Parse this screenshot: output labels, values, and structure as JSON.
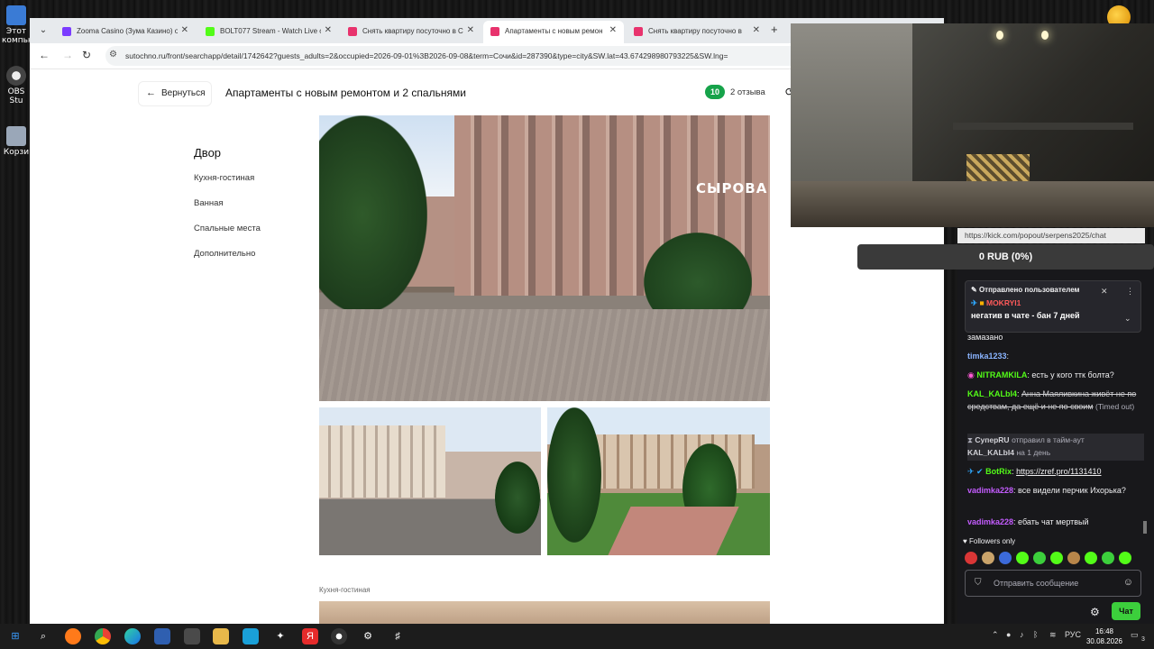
{
  "desktop": {
    "icons": [
      {
        "label": "Этот компью",
        "icon": "computer-icon",
        "color": "#3a7bd5"
      },
      {
        "label": "OBS Stu",
        "icon": "obs-icon",
        "color": "#444444"
      },
      {
        "label": "Корзи",
        "icon": "recycle-bin-icon",
        "color": "#9aa7b8"
      }
    ]
  },
  "browser": {
    "tabs": [
      {
        "title": "Zooma Casino (Зума Казино) о",
        "favicon_color": "#7b3cff",
        "active": false
      },
      {
        "title": "BOLT077 Stream - Watch Live o",
        "favicon_color": "#53fc18",
        "active": false
      },
      {
        "title": "Снять квартиру посуточно в С",
        "favicon_color": "#e8336d",
        "active": false
      },
      {
        "title": "Апартаменты с новым ремон",
        "favicon_color": "#e8336d",
        "active": true
      },
      {
        "title": "Снять квартиру посуточно в",
        "favicon_color": "#e8336d",
        "active": false
      }
    ],
    "url": "sutochno.ru/front/searchapp/detail/1742642?guests_adults=2&occupied=2026-09-01%3B2026-09-08&term=Сочи&id=287390&type=city&SW.lat=43.674298980793225&SW.lng="
  },
  "page": {
    "back_label": "Вернуться",
    "title": "Апартаменты с новым ремонтом и 2 спальнями",
    "rating": "10",
    "reviews": "2 отзыва",
    "nav": {
      "heading": "Двор",
      "items": [
        "Кухня-гостиная",
        "Ванная",
        "Спальные места",
        "Дополнительно"
      ]
    },
    "photo_sign": "СЫРОВА",
    "section_label": "Кухня-гостиная"
  },
  "stream": {
    "chat_url": "https://kick.com/popout/serpens2025/chat",
    "donation": "0 RUB (0%)"
  },
  "chat": {
    "pinned": {
      "title": "Отправлено пользователем",
      "user": "MOKRYI1",
      "text": "негатив в чате - бан 7 дней"
    },
    "messages": [
      {
        "user": "",
        "text": "замазано",
        "user_color": "#efeff1"
      },
      {
        "user": "timka1233",
        "text": ":",
        "user_color": "#8ab4ff"
      },
      {
        "user": "NITRAMKILA",
        "text": ": есть у кого ттк болта?",
        "user_color": "#53fc18"
      },
      {
        "user": "KAL_KALbI4",
        "text": "Анна Маяливкина живёт не по средствам, да ещё и не по своим",
        "note": "(Timed out)",
        "user_color": "#53fc18"
      },
      {
        "user": "СуперRU",
        "text": "отправил в тайм-аут",
        "user2": "KAL_KALbI4",
        "duration": "на 1 день",
        "user_color": "#adadb8"
      },
      {
        "user": "BotRix",
        "text": "https://zref.pro/1131410",
        "user_color": "#53fc18"
      },
      {
        "user": "vadimka228",
        "text": ": все видели перчик Ихорька?",
        "user_color": "#c45cff"
      },
      {
        "user": "vadimka228",
        "text": ": ебать чат мертвый",
        "user_color": "#c45cff"
      }
    ],
    "followers_only": "Followers only",
    "input_placeholder": "Отправить сообщение",
    "send_label": "Чат"
  },
  "taskbar": {
    "lang": "РУС",
    "time": "16:48",
    "date": "30.08.2026",
    "notifications": "3"
  },
  "colors": {
    "accent_green": "#16a34a",
    "kick_green": "#53fc18",
    "chat_bg": "#18181b"
  }
}
